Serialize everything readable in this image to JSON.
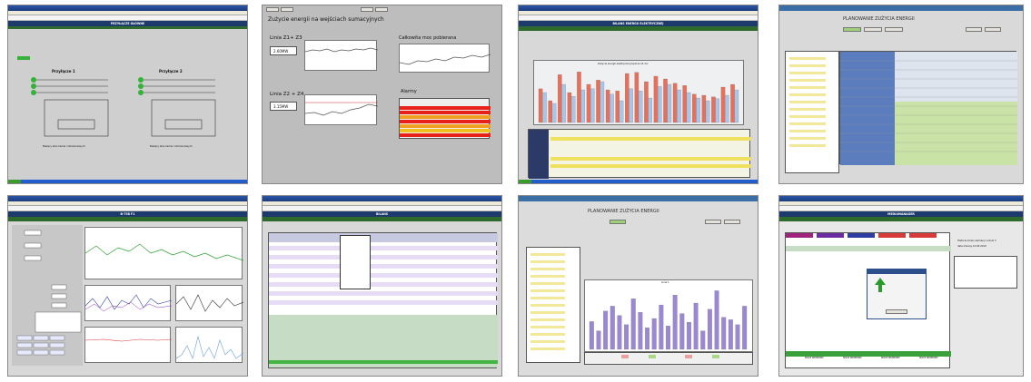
{
  "tiles": [
    {
      "id": "t1",
      "title": "PRZYŁĄCZE GŁÓWNE",
      "panel_left": "Przyłącze 1",
      "panel_right": "Przyłącze 2",
      "caption_left": "Bieżący stan kamer rozliczeniowych",
      "caption_right": "Bieżący stan kamer rozliczeniowych"
    },
    {
      "id": "t2",
      "heading": "Zużycie energii na wejściach sumacyjnych",
      "line1": "Linia Z1+ Z3",
      "line2": "Linia Z2 + Z4",
      "total": "Całkowita moc pobierana",
      "alarms": "Alarmy",
      "value1": "2.60MW",
      "value2": "3.15MW"
    },
    {
      "id": "t3",
      "title": "BILANS ENERGII ELEKTRYCZNEJ",
      "chart_title": "Zużycie energii elektrycznej łącznie 14 dni"
    },
    {
      "id": "t4",
      "title": "PLANOWANIE ZUŻYCIA ENERGII"
    },
    {
      "id": "t5",
      "title": "B-758 F1"
    },
    {
      "id": "t6",
      "title": "BILANS"
    },
    {
      "id": "t7",
      "title": "PLANOWANIE ZUŻYCIA ENERGII",
      "chart_label": "Linia 1"
    },
    {
      "id": "t8",
      "title": "MEDIAMANAGER",
      "info": "Historia zmian zamiany Licznik 3",
      "date": "data zmiany 12.05.2010",
      "section_labels": [
        "NISKIE NIEZBEDNE",
        "NISKIE NIEZBEDNE",
        "NISKIE NIEZBEDNE",
        "NISKIE NIEZBEDNE"
      ]
    }
  ],
  "colors": {
    "navy": "#1d3a6c",
    "green": "#2e6a2c",
    "red": "#e8705a",
    "blue": "#a9c5e8",
    "purple": "#9b87d4",
    "olive": "#c8dc8a"
  },
  "chart_t3": {
    "type": "bar",
    "series": [
      {
        "values": [
          62,
          40,
          88,
          55,
          93,
          70,
          78,
          60,
          58,
          90,
          92,
          75,
          85,
          80,
          72,
          68,
          52,
          50,
          47,
          65,
          70
        ]
      },
      {
        "values": [
          55,
          35,
          70,
          48,
          60,
          62,
          75,
          52,
          40,
          62,
          58,
          45,
          66,
          70,
          60,
          55,
          45,
          40,
          44,
          50,
          60
        ]
      }
    ]
  },
  "chart_t7": {
    "type": "bar",
    "values": [
      45,
      30,
      62,
      70,
      55,
      40,
      82,
      60,
      35,
      50,
      72,
      38,
      88,
      58,
      44,
      75,
      30,
      65,
      95,
      52,
      48,
      40,
      70
    ]
  }
}
